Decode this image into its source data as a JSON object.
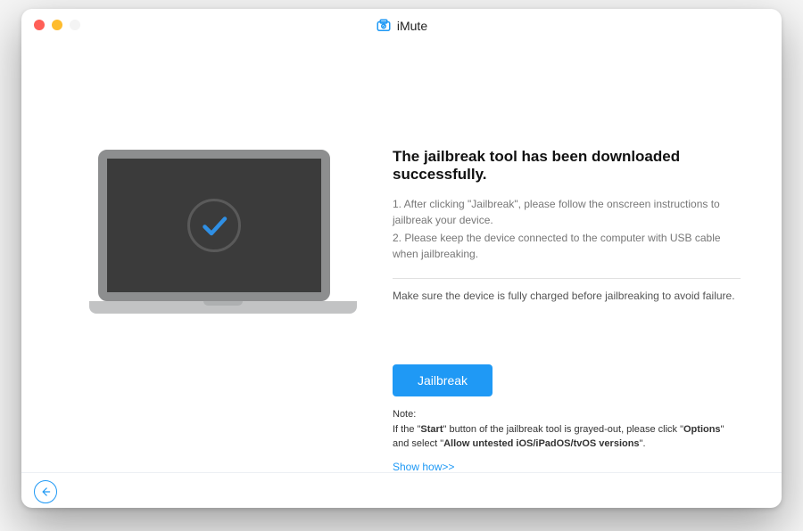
{
  "app": {
    "title": "iMute"
  },
  "main": {
    "headline": "The jailbreak tool has been downloaded successfully.",
    "instruction1": "1. After clicking \"Jailbreak\", please follow the onscreen instructions to jailbreak your device.",
    "instruction2": "2. Please keep the device connected to the computer with USB cable when jailbreaking.",
    "warning": "Make sure the device is fully charged before jailbreaking to avoid failure.",
    "cta_label": "Jailbreak",
    "note": {
      "lead": "Note:",
      "pre": "If the \"",
      "b1": "Start",
      "mid1": "\" button of the jailbreak tool is grayed-out, please click \"",
      "b2": "Options",
      "mid2": "\" and select \"",
      "b3": "Allow untested iOS/iPadOS/tvOS versions",
      "post": "\"."
    },
    "show_how": "Show how>>"
  }
}
